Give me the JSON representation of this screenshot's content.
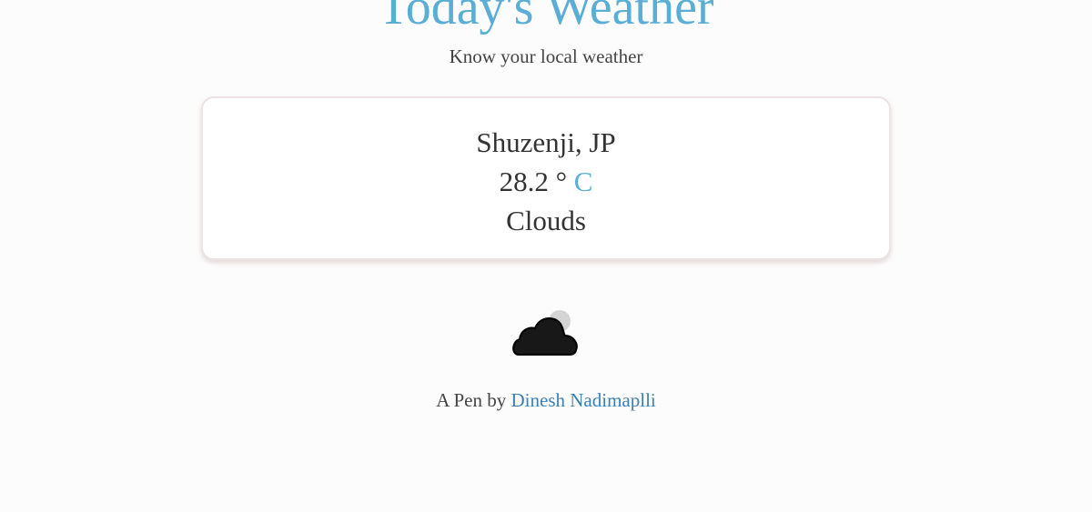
{
  "header": {
    "title": "Today's Weather",
    "subtitle": "Know your local weather"
  },
  "weather": {
    "location": "Shuzenji, JP",
    "temperature": "28.2",
    "degree_symbol": "°",
    "unit": "C",
    "condition": "Clouds",
    "icon": "cloud-icon"
  },
  "footer": {
    "prefix": "A Pen by",
    "author": "Dinesh Nadimaplli"
  },
  "colors": {
    "accent": "#5aaed6",
    "link": "#3b7fb6",
    "text": "#333333",
    "background": "#fdfcfc"
  }
}
